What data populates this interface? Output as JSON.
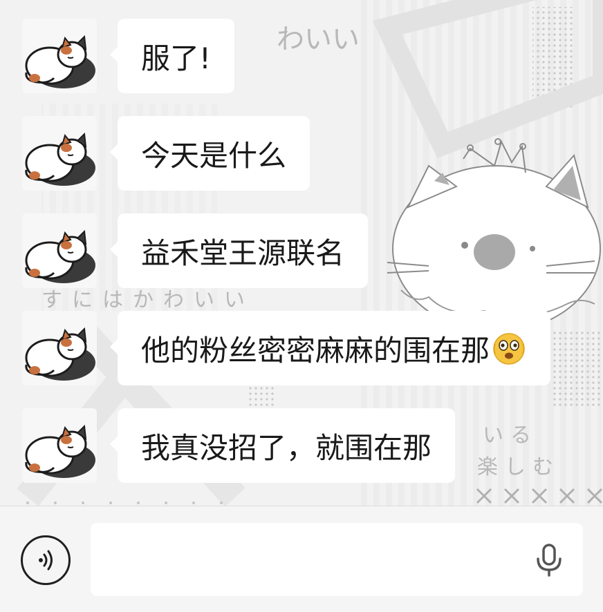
{
  "messages": [
    {
      "text": "服了!",
      "emoji": null
    },
    {
      "text": "今天是什么",
      "emoji": null
    },
    {
      "text": "益禾堂王源联名",
      "emoji": null
    },
    {
      "text": "他的粉丝密密麻麻的围在那",
      "emoji": "shaking-face-icon"
    },
    {
      "text": "我真没招了，就围在那",
      "emoji": null
    }
  ],
  "input": {
    "value": "",
    "placeholder": ""
  },
  "wallpaper_text": {
    "hiragana_top": "わいい",
    "hiragana_row": "すにはかわいい",
    "japanese_right": "いる",
    "japanese_bottom": "楽しむ"
  },
  "colors": {
    "bubble": "#ffffff",
    "chat_background": "#f1f1f1",
    "input_bar": "#f5f5f5",
    "text": "#191919"
  }
}
